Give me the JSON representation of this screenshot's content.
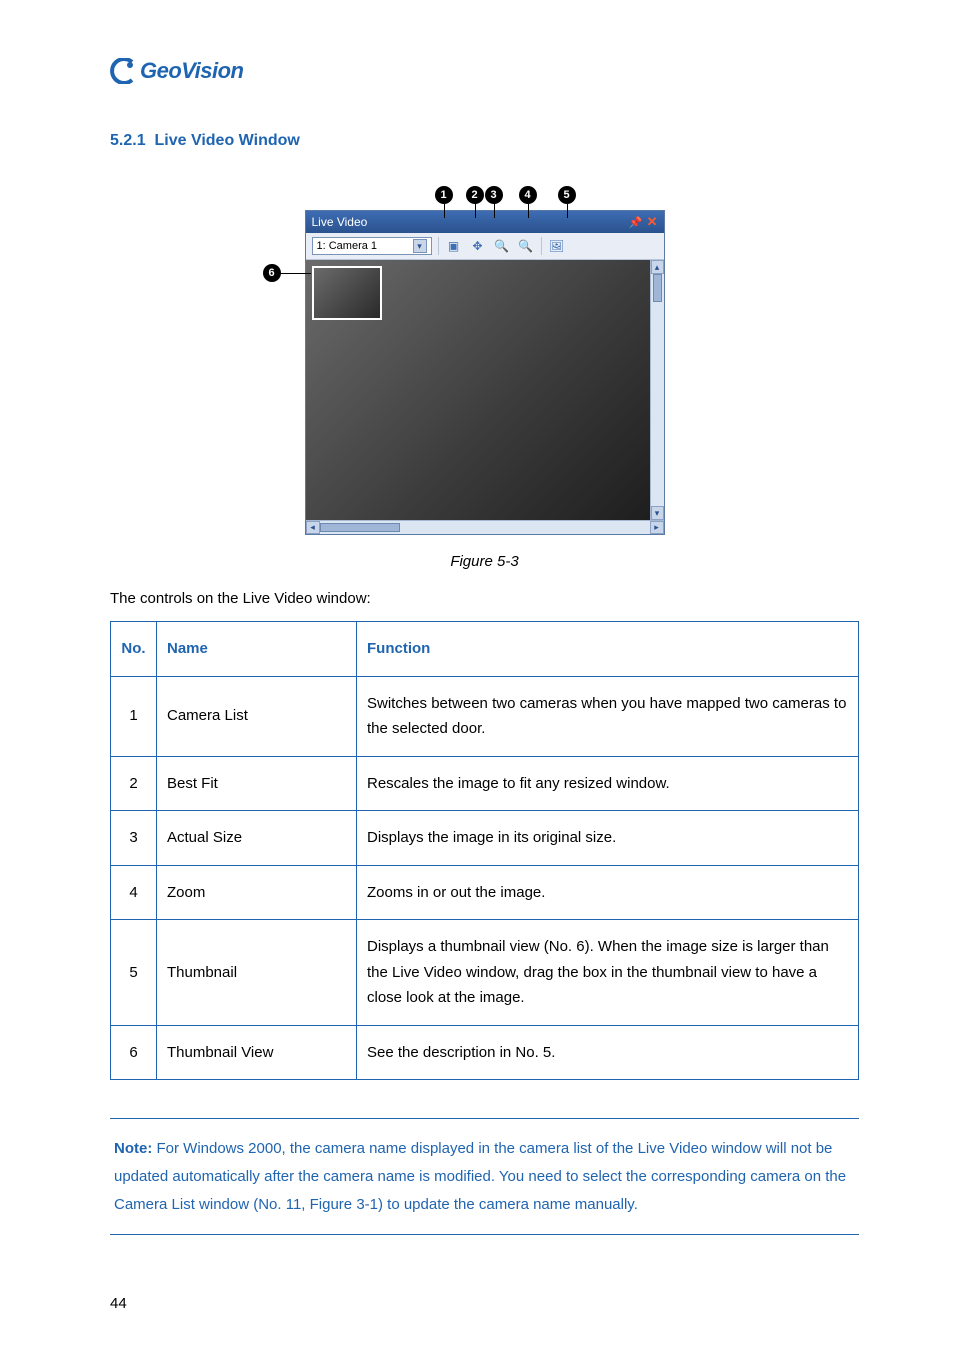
{
  "logo_text": "GeoVision",
  "section": {
    "number": "5.2.1",
    "title": "Live Video Window"
  },
  "figure": {
    "panel_title": "Live Video",
    "camera_select": "1: Camera 1",
    "callouts": [
      "1",
      "2",
      "3",
      "4",
      "5",
      "6"
    ],
    "caption": "Figure 5-3"
  },
  "intro": "The controls on the Live Video window:",
  "table": {
    "headers": {
      "no": "No.",
      "name": "Name",
      "function": "Function"
    },
    "rows": [
      {
        "no": "1",
        "name": "Camera List",
        "function": "Switches between two cameras when you have mapped two cameras to the selected door."
      },
      {
        "no": "2",
        "name": "Best Fit",
        "function": "Rescales the image to fit any resized window."
      },
      {
        "no": "3",
        "name": "Actual Size",
        "function": "Displays the image in its original size."
      },
      {
        "no": "4",
        "name": "Zoom",
        "function": "Zooms in or out the image."
      },
      {
        "no": "5",
        "name": "Thumbnail",
        "function": "Displays a thumbnail view (No. 6). When the image size is larger than the Live Video window, drag the box in the thumbnail view to have a close look at the image."
      },
      {
        "no": "6",
        "name": "Thumbnail View",
        "function": "See the description in No. 5."
      }
    ]
  },
  "note": {
    "label": "Note:",
    "text": " For Windows 2000, the camera name displayed in the camera list of the Live Video window will not be updated automatically after the camera name is modified. You need to select the corresponding camera on the Camera List window (No. 11, Figure 3-1) to update the camera name manually."
  },
  "page_number": "44"
}
